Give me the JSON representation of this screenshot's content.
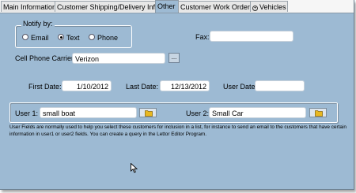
{
  "tabs": [
    {
      "label": "Main Information"
    },
    {
      "label": "Customer Shipping/Delivery Info"
    },
    {
      "label": "Other"
    },
    {
      "label": "Customer Work Orders"
    },
    {
      "label": "Vehicles",
      "icon": "vehicles-icon"
    }
  ],
  "notify": {
    "legend": "Notify by:",
    "options": [
      {
        "label": "Email",
        "selected": false
      },
      {
        "label": "Text",
        "selected": true
      },
      {
        "label": "Phone",
        "selected": false
      }
    ]
  },
  "fax": {
    "label": "Fax:",
    "value": ""
  },
  "carrier": {
    "label": "Cell Phone Carrier:",
    "value": "Verizon",
    "button_label": "..."
  },
  "dates": {
    "first_label": "First Date:",
    "first_value": "1/10/2012",
    "last_label": "Last Date:",
    "last_value": "12/13/2012",
    "user_label": "User Date:",
    "user_value": ""
  },
  "user_fields": {
    "user1_label": "User 1:",
    "user1_value": "small boat",
    "user2_label": "User 2:",
    "user2_value": "Small Car"
  },
  "note": "User Fields are normally used to help you select these customers for inclusion in a list, for instance to send an email to the customers that have certain information in user1 or user2 fields. You can create a query in the Lettor Editor Program.",
  "colors": {
    "panel_bg": "#9dbad3",
    "tab_strip": "#f6f6f6"
  }
}
